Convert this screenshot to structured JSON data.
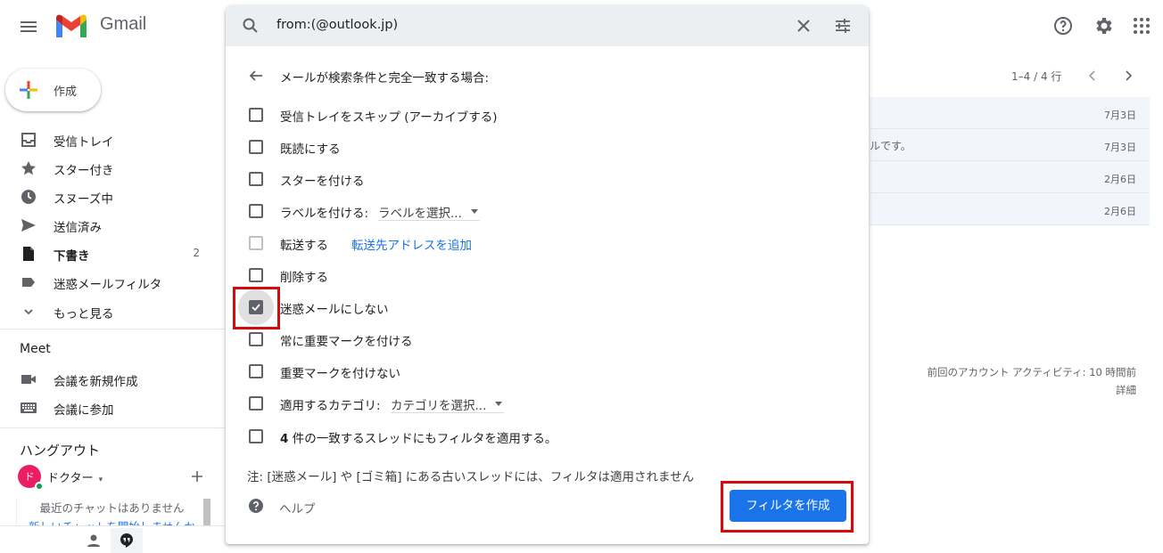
{
  "header": {
    "brand": "Gmail",
    "icons": [
      "menu-icon",
      "help-icon",
      "settings-icon",
      "apps-icon"
    ]
  },
  "sidebar": {
    "compose_label": "作成",
    "items": [
      {
        "label": "受信トレイ",
        "icon": "inbox-icon",
        "count": ""
      },
      {
        "label": "スター付き",
        "icon": "star-icon",
        "count": ""
      },
      {
        "label": "スヌーズ中",
        "icon": "clock-icon",
        "count": ""
      },
      {
        "label": "送信済み",
        "icon": "send-icon",
        "count": ""
      },
      {
        "label": "下書き",
        "icon": "draft-icon",
        "count": "2"
      },
      {
        "label": "迷惑メールフィルタ",
        "icon": "label-icon",
        "count": ""
      },
      {
        "label": "もっと見る",
        "icon": "chevron-down-icon",
        "count": ""
      }
    ],
    "meet": {
      "title": "Meet",
      "items": [
        {
          "label": "会議を新規作成",
          "icon": "video-icon"
        },
        {
          "label": "会議に参加",
          "icon": "keyboard-icon"
        }
      ]
    },
    "hangouts": {
      "title": "ハングアウト",
      "user_name": "ドクター",
      "avatar_letter": "ド",
      "empty_text": "最近のチャットはありません",
      "start_link": "新しいチャットを開始しませんか"
    }
  },
  "mail_list": {
    "pagination": "1–4 / 4 行",
    "rows": [
      {
        "snippet": "",
        "date": "7月3日"
      },
      {
        "snippet": "ルです。",
        "date": "7月3日"
      },
      {
        "snippet": "",
        "date": "2月6日"
      },
      {
        "snippet": "",
        "date": "2月6日"
      }
    ],
    "activity": "前回のアカウント アクティビティ: 10 時間前",
    "details_link": "詳細"
  },
  "filter_dialog": {
    "search_value": "from:(@outlook.jp)",
    "heading": "メールが検索条件と完全一致する場合:",
    "options": [
      {
        "label": "受信トレイをスキップ (アーカイブする)",
        "checked": false
      },
      {
        "label": "既読にする",
        "checked": false
      },
      {
        "label": "スターを付ける",
        "checked": false
      },
      {
        "label": "ラベルを付ける:",
        "checked": false,
        "select": "ラベルを選択..."
      },
      {
        "label": "転送する",
        "checked": false,
        "link": "転送先アドレスを追加"
      },
      {
        "label": "削除する",
        "checked": false
      },
      {
        "label": "迷惑メールにしない",
        "checked": true
      },
      {
        "label": "常に重要マークを付ける",
        "checked": false
      },
      {
        "label": "重要マークを付けない",
        "checked": false
      },
      {
        "label": "適用するカテゴリ:",
        "checked": false,
        "select": "カテゴリを選択..."
      },
      {
        "label_count": "4",
        "label": "件の一致するスレッドにもフィルタを適用する。",
        "checked": false
      }
    ],
    "note": "注: [迷惑メール] や [ゴミ箱] にある古いスレッドには、フィルタは適用されません",
    "help_label": "ヘルプ",
    "create_button": "フィルタを作成"
  },
  "colors": {
    "accent": "#1a73e8",
    "highlight": "#d60a0a",
    "search_bg": "#eceff1"
  }
}
